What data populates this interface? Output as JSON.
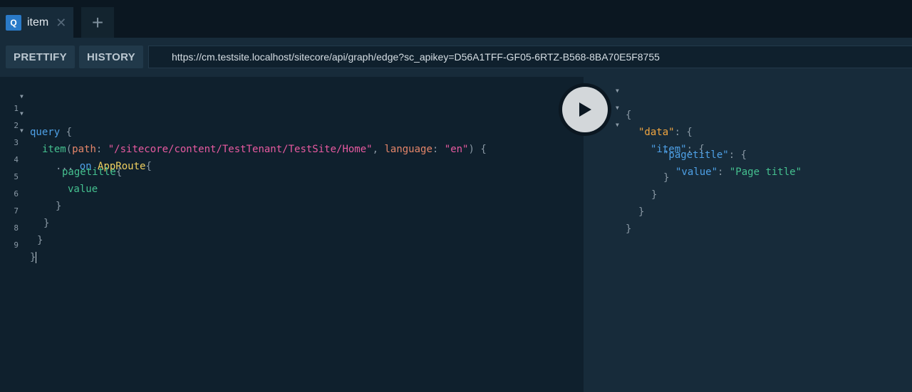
{
  "tabs": [
    {
      "badge": "Q",
      "label": "item",
      "close": "✕"
    }
  ],
  "new_tab_label": "+",
  "toolbar": {
    "prettify_label": "PRETTIFY",
    "history_label": "HISTORY",
    "url": "https://cm.testsite.localhost/sitecore/api/graph/edge?sc_apikey=D56A1TFF-GF05-6RTZ-B568-8BA70E5F8755"
  },
  "editor": {
    "line_numbers": [
      "1",
      "2",
      "3",
      "4",
      "5",
      "6",
      "7",
      "8",
      "9"
    ],
    "l1": {
      "kw": "query",
      "brace": " {"
    },
    "l2": {
      "fn": "item",
      "p1": "(",
      "a1": "path",
      "c1": ": ",
      "s1": "\"/sitecore/content/TestTenant/TestSite/Home\"",
      "c2": ", ",
      "a2": "language",
      "c3": ": ",
      "s2": "\"en\"",
      "p2": ") {"
    },
    "l3": {
      "dots": "... ",
      "kw": "on",
      "typ": "AppRoute",
      "brace": "{"
    },
    "l4": {
      "fld": "pagetitle",
      "brace": "{"
    },
    "l5": {
      "fld": "value"
    },
    "l6": "}",
    "l7": "}",
    "l8": "}",
    "l9": "}"
  },
  "results": {
    "r1": "{",
    "r2": {
      "key": "\"data\"",
      "rest": ": {"
    },
    "r3": {
      "key": "\"item\"",
      "rest": ": {"
    },
    "r4": {
      "key": "\"pagetitle\"",
      "rest": ": {"
    },
    "r5": {
      "key": "\"value\"",
      "colon": ": ",
      "val": "\"Page title\""
    },
    "r6": "}",
    "r7": "}",
    "r8": "}",
    "r9": "}"
  },
  "colors": {
    "background": "#0f202d",
    "toolbar": "#172b3a",
    "accent": "#2a7ac8"
  }
}
